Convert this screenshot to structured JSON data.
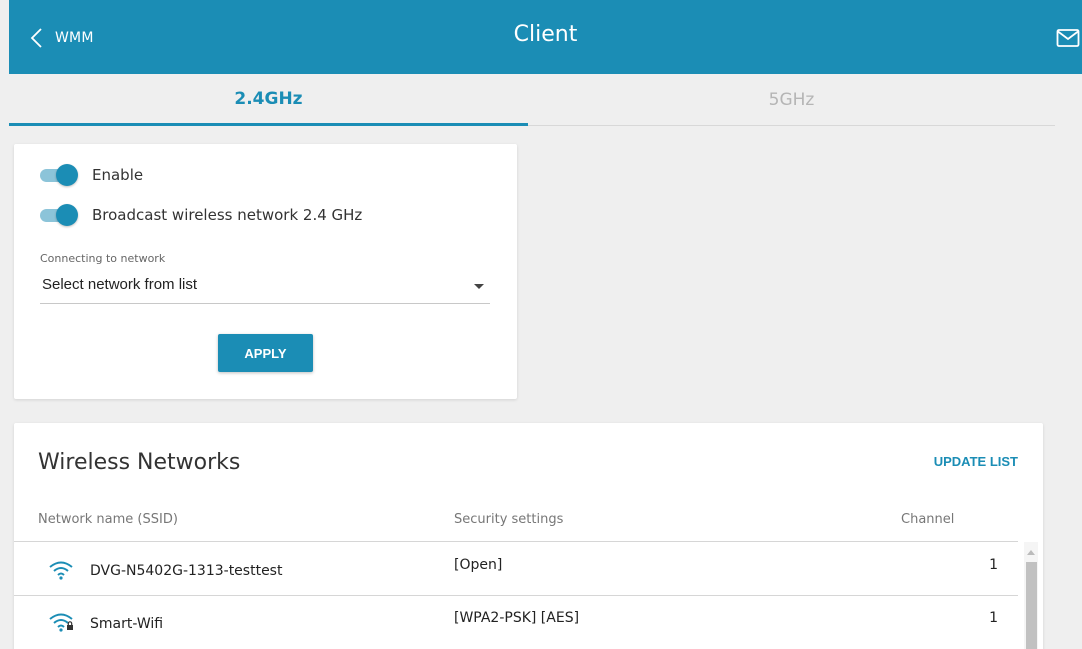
{
  "header": {
    "back_label": "WMM",
    "title": "Client",
    "icons": {
      "back": "chevron-left-icon",
      "mail": "mail-icon"
    }
  },
  "tabs": [
    {
      "label": "2.4GHz",
      "active": true
    },
    {
      "label": "5GHz",
      "active": false
    }
  ],
  "settings": {
    "enable_label": "Enable",
    "enable_on": true,
    "broadcast_label": "Broadcast wireless network 2.4 GHz",
    "broadcast_on": true,
    "connecting_label": "Connecting to network",
    "connecting_value": "Select network from list",
    "apply_label": "APPLY"
  },
  "networks": {
    "title": "Wireless Networks",
    "update_label": "UPDATE LIST",
    "columns": {
      "ssid": "Network name (SSID)",
      "security": "Security settings",
      "channel": "Channel"
    },
    "rows": [
      {
        "ssid": "DVG-N5402G-1313-testtest",
        "security": "[Open]",
        "channel": "1",
        "icon": "wifi-icon"
      },
      {
        "ssid": "Smart-Wifi",
        "security": "[WPA2-PSK] [AES]",
        "channel": "1",
        "icon": "wifi-lock-icon"
      }
    ]
  },
  "colors": {
    "accent": "#1b8db5",
    "background": "#efefef",
    "toggle_track": "#8cc4d9"
  }
}
